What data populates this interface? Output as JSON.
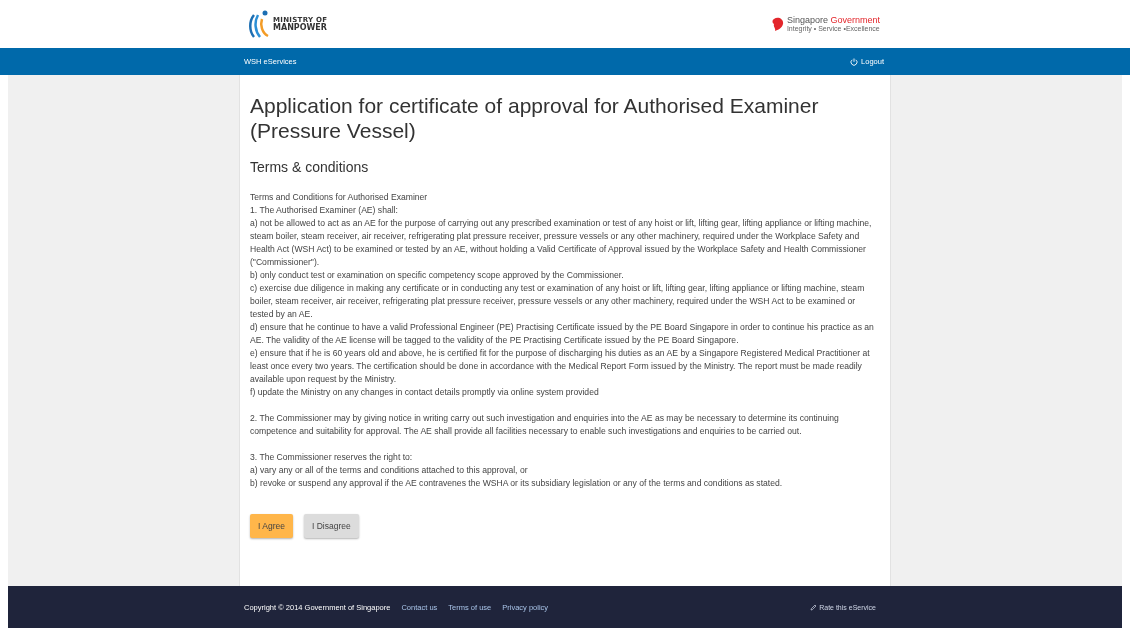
{
  "header": {
    "ministry_logo": {
      "line1": "MINISTRY OF",
      "line2": "MANPOWER"
    },
    "gov_logo": {
      "name": "Singapore",
      "name_accent": "Government",
      "tagline": "Integrity • Service •Excellence"
    }
  },
  "navbar": {
    "title": "WSH eServices",
    "logout": "Logout"
  },
  "title": "Application for certificate of approval for Authorised Examiner (Pressure Vessel)",
  "section_heading": "Terms & conditions",
  "terms": [
    [
      "Terms and Conditions for Authorised Examiner",
      "1. The Authorised Examiner (AE) shall:",
      "a) not be allowed to act as an AE for the purpose of carrying out any prescribed examination or test of any hoist or lift, lifting gear, lifting appliance or lifting machine, steam boiler, steam receiver, air receiver, refrigerating plat pressure receiver, pressure vessels or any other machinery, required under the Workplace Safety and Health Act (WSH Act) to be examined or tested by an AE, without holding a Valid Certificate of Approval issued by the Workplace Safety and Health Commissioner (\"Commissioner\").",
      "b) only conduct test or examination on specific competency scope approved by the Commissioner.",
      "c) exercise due diligence in making any certificate or in conducting any test or examination of any hoist or lift, lifting gear, lifting appliance or lifting machine, steam boiler, steam receiver, air receiver, refrigerating plat pressure receiver, pressure vessels or any other machinery, required under the WSH Act to be examined or tested by an AE.",
      "d) ensure that he continue to have a valid Professional Engineer (PE) Practising Certificate issued by the PE Board Singapore in order to continue his practice as an AE. The validity of the AE license will be tagged to the validity of the PE Practising Certificate issued by the PE Board Singapore.",
      "e) ensure that if he is 60 years old and above, he is certified fit for the purpose of discharging his duties as an AE by a Singapore Registered Medical Practitioner at least once every two years. The certification should be done in accordance with the Medical Report Form issued by the Ministry. The report must be made readily available upon request by the Ministry.",
      "f) update the Ministry on any changes in contact details promptly via online system provided"
    ],
    [
      "2. The Commissioner may by giving notice in writing carry out such investigation and enquiries into the AE as may be necessary to determine its continuing competence and suitability for approval. The AE shall provide all facilities necessary to enable such investigations and enquiries to be carried out."
    ],
    [
      "3. The Commissioner reserves the right to:",
      "a) vary any or all of the terms and conditions attached to this approval, or",
      "b) revoke or suspend any approval if the AE contravenes the WSHA or its subsidiary legislation or any of the terms and conditions as stated."
    ]
  ],
  "buttons": [
    {
      "label": "I Agree",
      "kind": "primary"
    },
    {
      "label": "I Disagree",
      "kind": "secondary"
    }
  ],
  "footer": {
    "copyright": "Copyright © 2014 Government of Singapore",
    "links": [
      "Contact us",
      "Terms of use",
      "Privacy policy"
    ],
    "rate": "Rate this eService"
  }
}
